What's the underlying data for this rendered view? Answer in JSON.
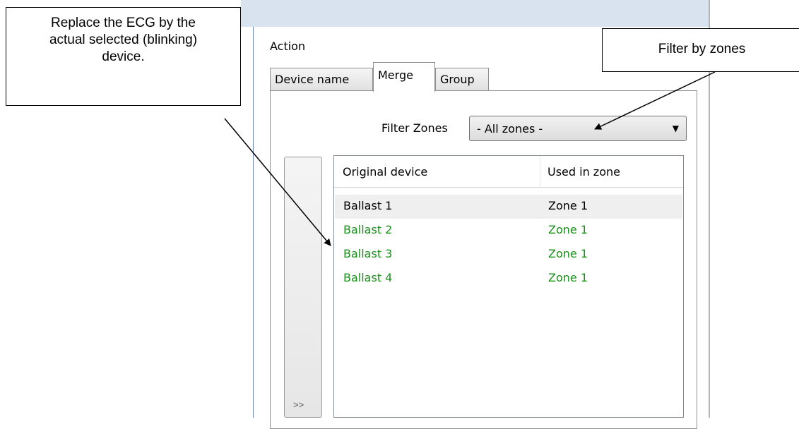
{
  "annotations": {
    "left_callout": [
      "Replace the ECG by the",
      "actual selected (blinking)",
      "device."
    ],
    "right_callout": "Filter by zones"
  },
  "panel": {
    "group_label": "Action",
    "tabs": [
      {
        "label": "Device name",
        "active": false
      },
      {
        "label": "Merge",
        "active": true
      },
      {
        "label": "Group",
        "active": false
      }
    ],
    "filter": {
      "label": "Filter Zones",
      "selected": "- All zones -"
    },
    "move_button_label": ">>",
    "list": {
      "columns": [
        "Original device",
        "Used in zone"
      ],
      "rows": [
        {
          "device": "Ballast 1",
          "zone": "Zone 1",
          "state": "selected"
        },
        {
          "device": "Ballast 2",
          "zone": "Zone 1",
          "state": "green"
        },
        {
          "device": "Ballast 3",
          "zone": "Zone 1",
          "state": "green"
        },
        {
          "device": "Ballast 4",
          "zone": "Zone 1",
          "state": "green"
        }
      ]
    }
  },
  "colors": {
    "green_text": "#1a8f1a",
    "selected_row": "#efefef",
    "window_frame": "#d8e3ef"
  }
}
